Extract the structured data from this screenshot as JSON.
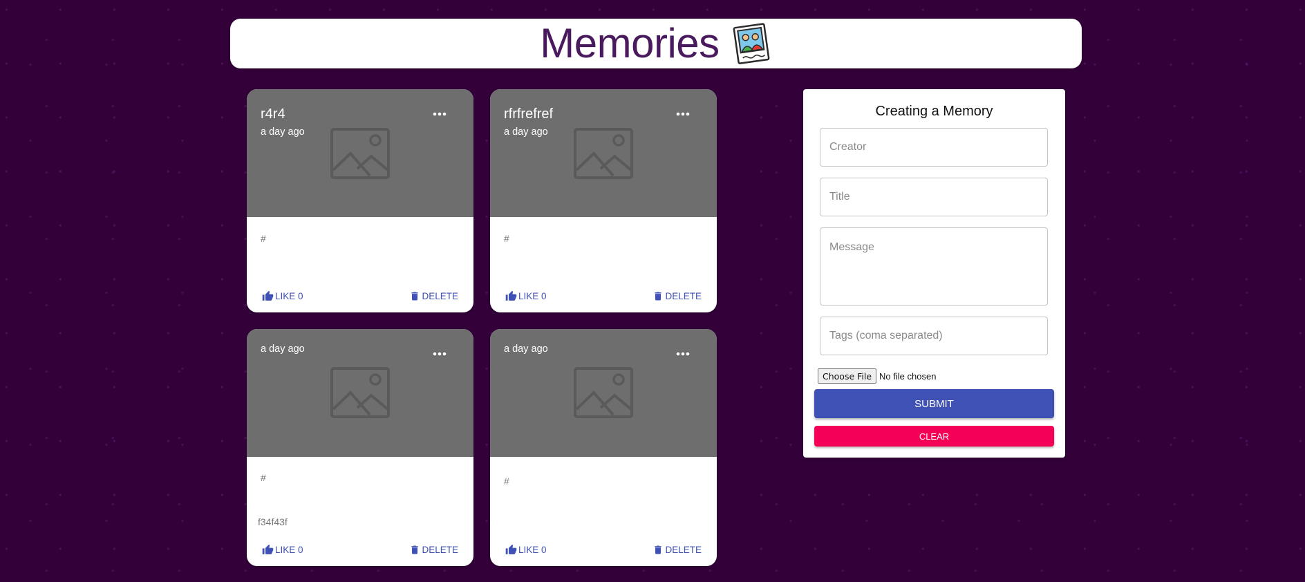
{
  "header": {
    "title": "Memories",
    "logo_icon": "memories-photo-logo-icon"
  },
  "posts": [
    {
      "creator": "r4r4",
      "time": "a day ago",
      "tags": "#",
      "message": "",
      "like_label": "LIKE 0",
      "delete_label": "DELETE"
    },
    {
      "creator": "rfrfrefref",
      "time": "a day ago",
      "tags": "#",
      "message": "",
      "like_label": "LIKE 0",
      "delete_label": "DELETE"
    },
    {
      "creator": "",
      "time": "a day ago",
      "tags": "#",
      "message": "f34f43f",
      "like_label": "LIKE 0",
      "delete_label": "DELETE"
    },
    {
      "creator": "",
      "time": "a day ago",
      "tags": "#",
      "message": "",
      "like_label": "LIKE 0",
      "delete_label": "DELETE"
    }
  ],
  "form": {
    "title": "Creating a Memory",
    "creator": {
      "value": "",
      "placeholder": "Creator"
    },
    "title_field": {
      "value": "",
      "placeholder": "Title"
    },
    "message": {
      "value": "",
      "placeholder": "Message"
    },
    "tags": {
      "value": "",
      "placeholder": "Tags (coma separated)"
    },
    "file_button_label": "Choose File",
    "file_status": "No file chosen",
    "submit_label": "SUBMIT",
    "clear_label": "CLEAR"
  },
  "colors": {
    "background": "#33003a",
    "title": "#4a1a5e",
    "primary": "#3f51b5",
    "secondary": "#f50057",
    "media_overlay": "#6e6e6e"
  }
}
